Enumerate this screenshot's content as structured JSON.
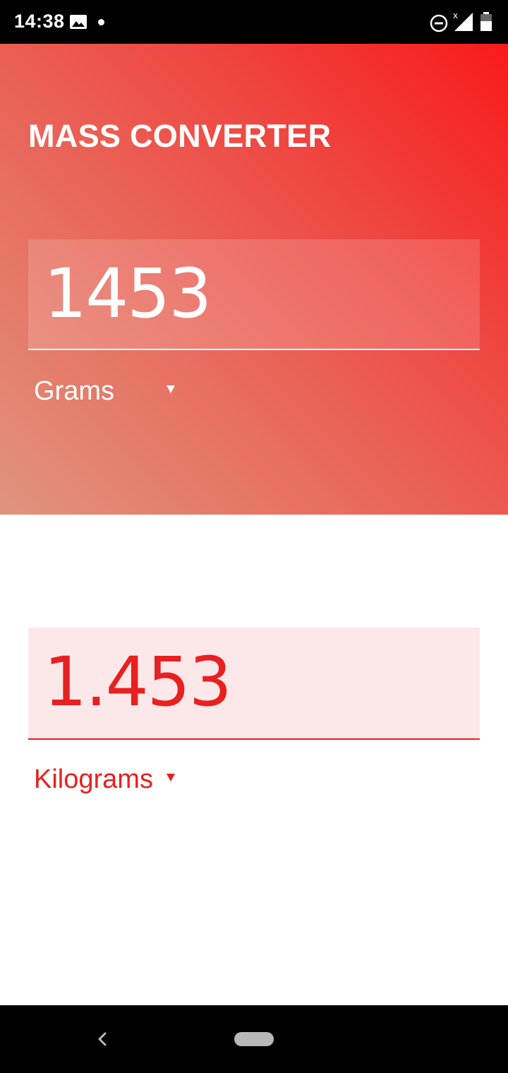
{
  "status_bar": {
    "time": "14:38",
    "icons": [
      "image-icon",
      "dot-icon",
      "do-not-disturb-icon",
      "signal-icon",
      "battery-icon"
    ]
  },
  "app": {
    "title": "MASS CONVERTER"
  },
  "input": {
    "value": "1453",
    "unit": "Grams"
  },
  "output": {
    "value": "1.453",
    "unit": "Kilograms"
  },
  "colors": {
    "accent": "#e82020",
    "gradient_start": "#f91a1b",
    "gradient_end": "#df947d",
    "output_bg": "#fce8e8"
  },
  "nav_bar": {
    "icons": [
      "back-icon",
      "home-pill"
    ]
  }
}
